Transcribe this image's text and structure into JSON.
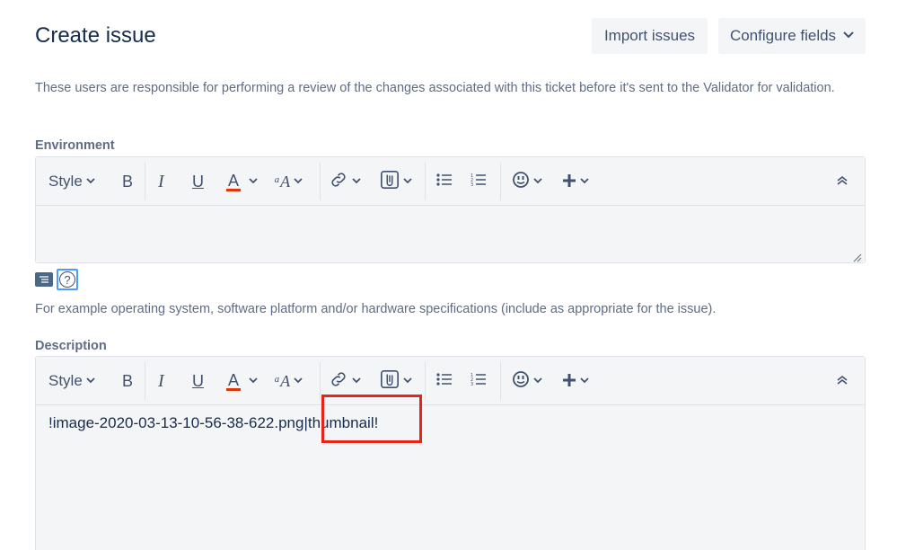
{
  "header": {
    "title": "Create issue",
    "import_label": "Import issues",
    "configure_label": "Configure fields"
  },
  "validator_help": "These users are responsible for performing a review of the changes associated with this ticket before it's sent to the Validator for validation.",
  "environment": {
    "label": "Environment",
    "value": "",
    "help": "For example operating system, software platform and/or hardware specifications (include as appropriate for the issue)."
  },
  "description": {
    "label": "Description",
    "value": "!image-2020-03-13-10-56-38-622.png|thumbnail!"
  },
  "toolbar": {
    "style_label": "Style",
    "bold": "B",
    "italic": "I",
    "underline": "U",
    "text_color": "A",
    "font": "ᵃA"
  },
  "colors": {
    "accent_red": "#de350b",
    "highlight_box": "#e8231a",
    "focus_blue": "#4c9aff"
  }
}
